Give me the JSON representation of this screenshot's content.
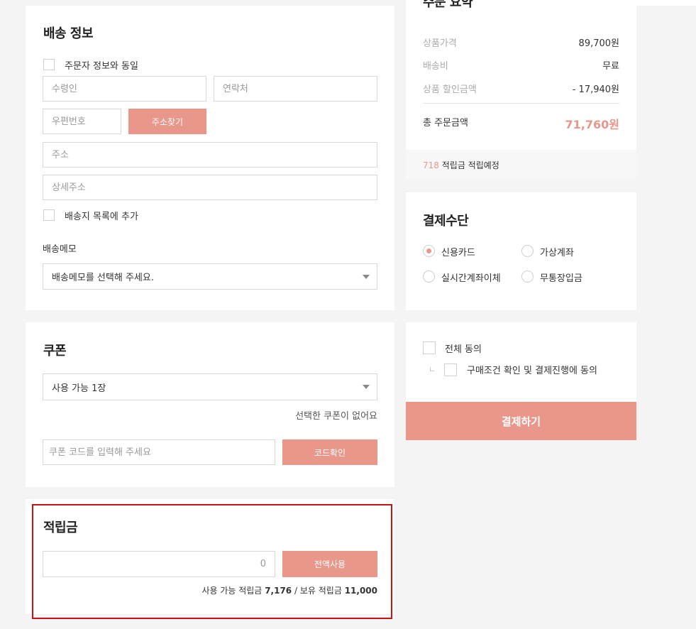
{
  "shipping": {
    "title": "배송 정보",
    "same_as_orderer_label": "주문자 정보와 동일",
    "recipient_placeholder": "수령인",
    "phone_placeholder": "연락처",
    "zipcode_placeholder": "우편번호",
    "find_address_label": "주소찾기",
    "address_placeholder": "주소",
    "address_detail_placeholder": "상세주소",
    "add_to_list_label": "배송지 목록에 추가",
    "memo_label": "배송메모",
    "memo_select_value": "배송메모를 선택해 주세요."
  },
  "coupon": {
    "title": "쿠폰",
    "select_value": "사용 가능 1장",
    "status_text": "선택한 쿠폰이 없어요",
    "code_placeholder": "쿠폰 코드를 입력해 주세요",
    "confirm_label": "코드확인"
  },
  "points": {
    "title": "적립금",
    "input_value": "0",
    "use_all_label": "전액사용",
    "info_prefix": "사용 가능 적립금",
    "available": "7,176",
    "separator": "/ 보유 적립금",
    "owned": "11,000"
  },
  "summary": {
    "title": "주문 요약",
    "rows": [
      {
        "label": "상품가격",
        "value": "89,700원"
      },
      {
        "label": "배송비",
        "value": "무료"
      },
      {
        "label": "상품 할인금액",
        "value": "- 17,940원"
      }
    ],
    "total_label": "총 주문금액",
    "total_value": "71,760원",
    "reward_amount": "718",
    "reward_text": "적립금 적립예정"
  },
  "payment": {
    "title": "결제수단",
    "methods": [
      {
        "label": "신용카드",
        "selected": true
      },
      {
        "label": "가상계좌",
        "selected": false
      },
      {
        "label": "실시간계좌이체",
        "selected": false
      },
      {
        "label": "무통장입금",
        "selected": false
      }
    ]
  },
  "agreement": {
    "all_label": "전체 동의",
    "purchase_label": "구매조건 확인 및 결제진행에 동의",
    "branch_glyph": "ㄴ"
  },
  "checkout": {
    "pay_label": "결제하기"
  },
  "colors": {
    "accent": "#e8978a",
    "total": "#e8978a",
    "highlight_border": "#cc1111",
    "background": "#f4f4f4"
  }
}
